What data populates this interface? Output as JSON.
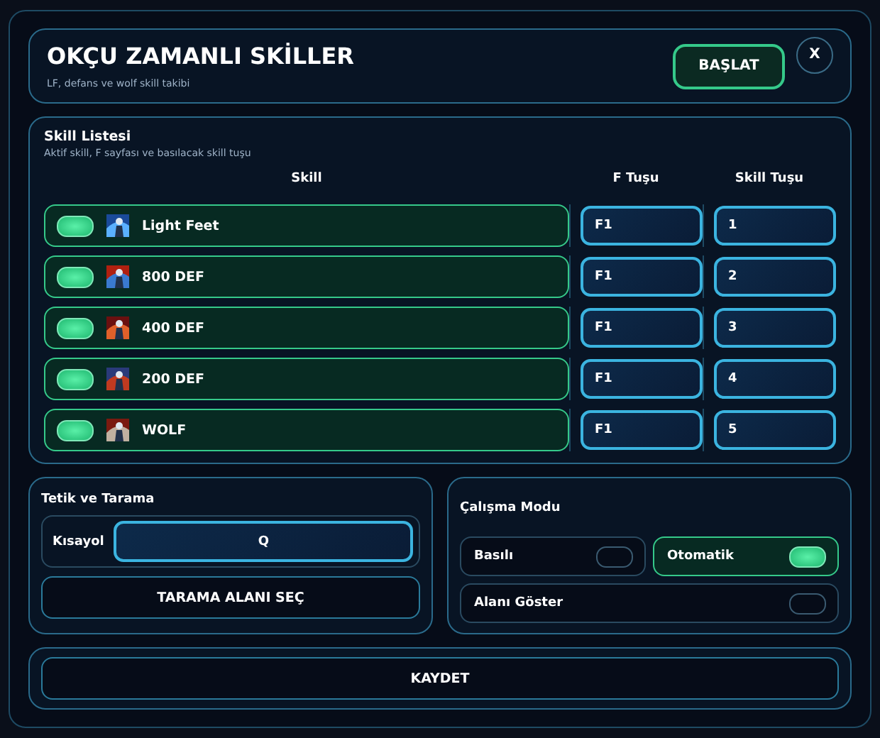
{
  "header": {
    "title": "OKÇU ZAMANLI SKİLLER",
    "subtitle": "LF, defans ve wolf skill takibi",
    "start_button": "BAŞLAT",
    "close_button": "X"
  },
  "skill_list": {
    "title": "Skill Listesi",
    "subtitle": "Aktif skill, F sayfası ve basılacak skill tuşu",
    "columns": [
      "Skill",
      "F Tuşu",
      "Skill Tuşu"
    ],
    "rows": [
      {
        "on": true,
        "name": "Light Feet",
        "f_key": "F1",
        "skill_key": "1"
      },
      {
        "on": true,
        "name": "800 DEF",
        "f_key": "F1",
        "skill_key": "2"
      },
      {
        "on": true,
        "name": "400 DEF",
        "f_key": "F1",
        "skill_key": "3"
      },
      {
        "on": true,
        "name": "200 DEF",
        "f_key": "F1",
        "skill_key": "4"
      },
      {
        "on": true,
        "name": "WOLF",
        "f_key": "F1",
        "skill_key": "5"
      }
    ]
  },
  "trigger": {
    "title": "Tetik ve Tarama",
    "shortcut_label": "Kısayol",
    "shortcut_value": "Q",
    "scan_button": "TARAMA ALANI SEÇ"
  },
  "mode": {
    "title": "Çalışma Modu",
    "options": [
      {
        "label": "Basılı",
        "on": false
      },
      {
        "label": "Otomatik",
        "on": true
      },
      {
        "label": "Alanı Göster",
        "on": false
      }
    ]
  },
  "save_button": "KAYDET"
}
